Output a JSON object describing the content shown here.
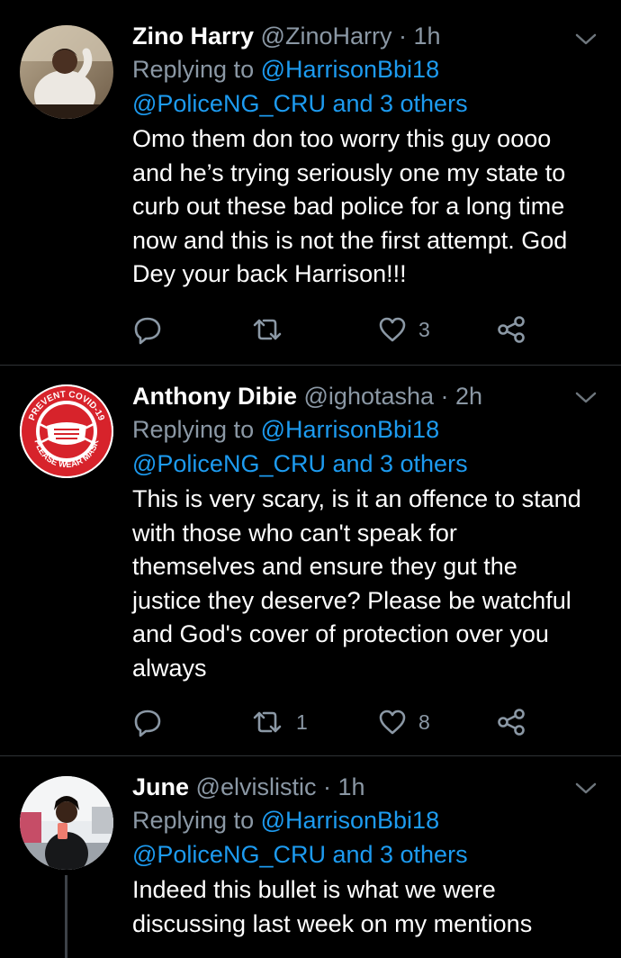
{
  "tweets": [
    {
      "name": "Zino Harry",
      "handle": "@ZinoHarry",
      "time": "· 1h",
      "replying_prefix": "Replying to ",
      "replying_to": "@HarrisonBbi18",
      "replying_others": "@PoliceNG_CRU and 3 others",
      "text": "Omo them don too worry this guy oooo and he’s trying seriously one my state to curb out these bad police for a long time now and this is not the first attempt. God Dey your back Harrison!!!",
      "retweets": "",
      "likes": "3"
    },
    {
      "name": "Anthony Dibie",
      "handle": "@ighotasha",
      "time": "· 2h",
      "replying_prefix": "Replying to ",
      "replying_to": "@HarrisonBbi18",
      "replying_others": "@PoliceNG_CRU and 3 others",
      "text": "This is very scary, is it an offence to stand with those who can't speak for themselves and ensure they gut the justice they deserve? Please be watchful and God's cover of protection over you always",
      "retweets": "1",
      "likes": "8",
      "avatar_badge": {
        "top_text": "PREVENT COVID-19",
        "bottom_text": "PLEASE WEAR MASK"
      }
    },
    {
      "name": "June",
      "handle": "@elvislistic",
      "time": "· 1h",
      "replying_prefix": "Replying to ",
      "replying_to": "@HarrisonBbi18",
      "replying_others": "@PoliceNG_CRU and 3 others",
      "text": "Indeed this bullet is what we were discussing last week on my mentions"
    }
  ],
  "colors": {
    "background": "#000000",
    "text": "#ffffff",
    "muted": "#8b98a5",
    "link": "#1d9bf0",
    "divider": "#2f3336",
    "badge_red": "#d7232b"
  }
}
